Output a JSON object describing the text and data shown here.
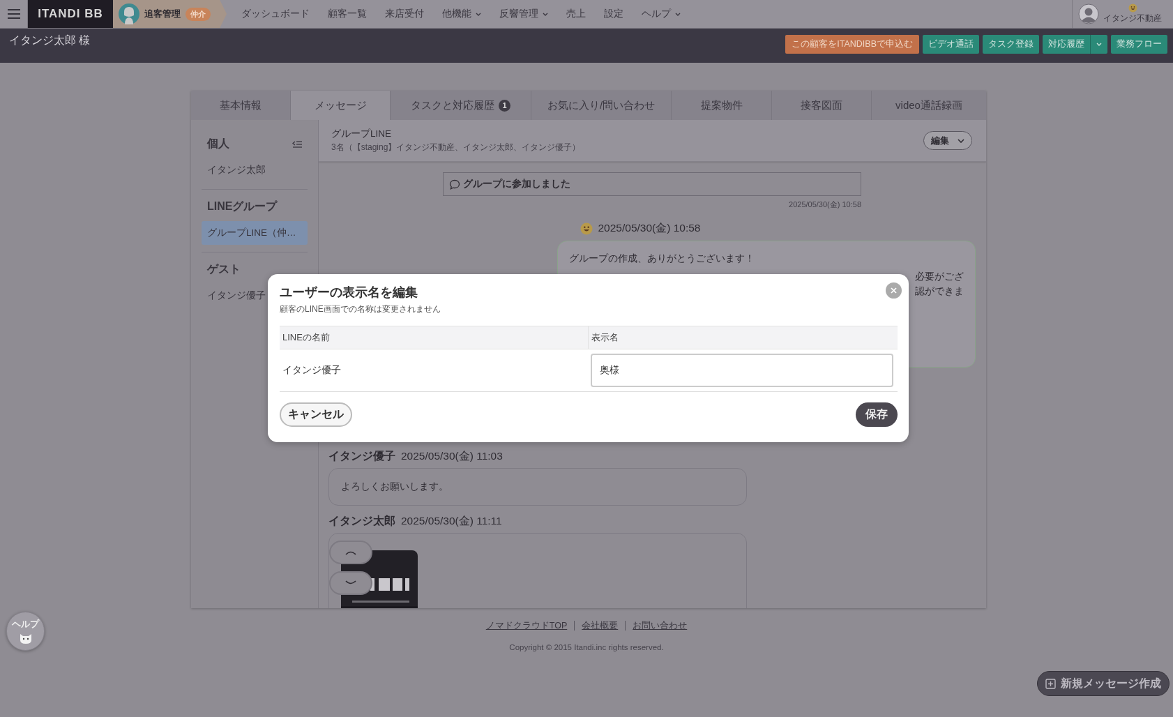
{
  "topbar": {
    "logo": "ITANDI BB",
    "section": "追客管理",
    "section_badge": "仲介",
    "nav": [
      {
        "label": "ダッシュボード",
        "dropdown": false
      },
      {
        "label": "顧客一覧",
        "dropdown": false
      },
      {
        "label": "来店受付",
        "dropdown": false
      },
      {
        "label": "他機能",
        "dropdown": true
      },
      {
        "label": "反響管理",
        "dropdown": true
      },
      {
        "label": "売上",
        "dropdown": false
      },
      {
        "label": "設定",
        "dropdown": false
      },
      {
        "label": "ヘルプ",
        "dropdown": true
      }
    ],
    "account": "イタンジ不動産"
  },
  "customer": {
    "name": "イタンジ太郎 様",
    "actions": [
      {
        "label": "この顧客をITANDIBBで申込む",
        "kind": "primary"
      },
      {
        "label": "ビデオ通話",
        "kind": "secondary"
      },
      {
        "label": "タスク登録",
        "kind": "secondary"
      },
      {
        "label": "対応履歴",
        "kind": "split"
      },
      {
        "label": "業務フロー",
        "kind": "secondary"
      }
    ]
  },
  "tabs": [
    {
      "label": "基本情報",
      "selected": false
    },
    {
      "label": "メッセージ",
      "selected": true
    },
    {
      "label": "タスクと対応履歴",
      "selected": false,
      "badge": "1"
    },
    {
      "label": "お気に入り/問い合わせ",
      "selected": false
    },
    {
      "label": "提案物件",
      "selected": false
    },
    {
      "label": "接客図面",
      "selected": false
    },
    {
      "label": "video通話録画",
      "selected": false
    }
  ],
  "sidebar": {
    "sections": [
      {
        "title": "個人",
        "items": [
          {
            "label": "イタンジ太郎",
            "selected": false
          }
        ]
      },
      {
        "title": "LINEグループ",
        "items": [
          {
            "label": "グループLINE（仲…",
            "selected": true
          }
        ]
      },
      {
        "title": "ゲスト",
        "items": [
          {
            "label": "イタンジ優子",
            "selected": false
          }
        ]
      }
    ]
  },
  "chat": {
    "title": "グループLINE",
    "members": "3名（【staging】イタンジ不動産、イタンジ太郎、イタンジ優子）",
    "edit_button": "編集",
    "messages": [
      {
        "kind": "event",
        "text": "グループに参加しました",
        "time": "2025/05/30(金) 10:58"
      },
      {
        "kind": "own",
        "time": "2025/05/30(金) 10:58",
        "text": "グループの作成、ありがとうございます！",
        "partial_lines": [
          "必要がござ",
          "認ができま"
        ]
      },
      {
        "kind": "text",
        "sender": "イタンジ優子",
        "time": "2025/05/30(金) 11:03",
        "text": "よろしくお願いします。"
      },
      {
        "sender": "イタンジ太郎",
        "time": "2025/05/30(金) 11:11"
      }
    ]
  },
  "footer": {
    "links": [
      "ノマドクラウドTOP",
      "会社概要",
      "お問い合わせ"
    ],
    "copyright": "Copyright © 2015 Itandi.inc rights reserved."
  },
  "help_button": "ヘルプ",
  "new_message_button": "新規メッセージ作成",
  "modal": {
    "title": "ユーザーの表示名を編集",
    "subtitle": "顧客のLINE画面での名称は変更されません",
    "columns": [
      "LINEの名前",
      "表示名"
    ],
    "rows": [
      {
        "line_name": "イタンジ優子",
        "display_name": "奥様"
      }
    ],
    "cancel_button": "キャンセル",
    "save_button": "保存"
  }
}
